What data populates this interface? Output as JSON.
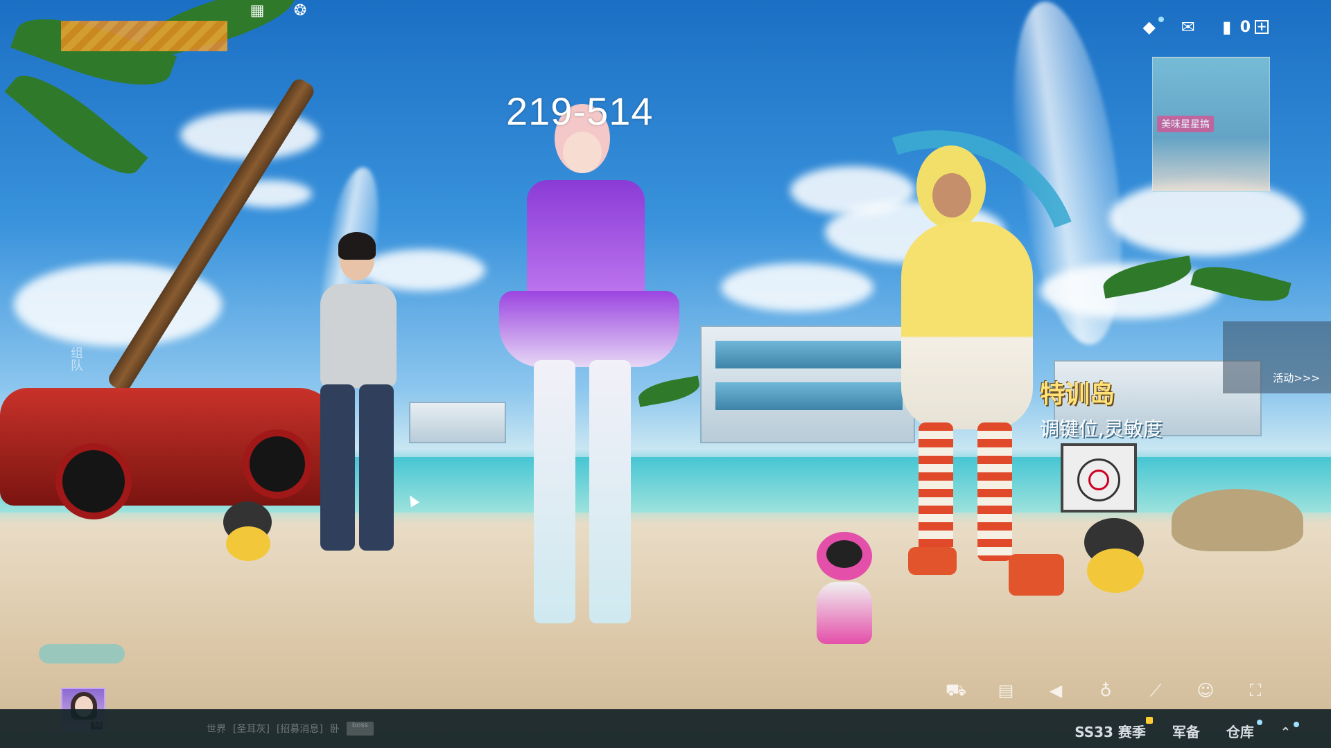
{
  "overlay": {
    "coordinates": "219-514"
  },
  "top_left": {
    "icons": [
      "grid-icon",
      "emblem-icon"
    ]
  },
  "top_right": {
    "icons": [
      "diamond-icon",
      "mail-icon",
      "card-icon"
    ],
    "currency_value": "0",
    "plus_label": "+"
  },
  "event_card": {
    "label": "美味星星搞"
  },
  "activity_card": {
    "label": "活动>>>"
  },
  "promo": {
    "title": "特训岛",
    "subtitle": "调键位,灵敏度"
  },
  "side": {
    "text": "组队"
  },
  "player": {
    "level": "38"
  },
  "chat": {
    "channel": "世界",
    "sender": "[圣耳灰]",
    "message": "[招募消息]",
    "suffix": "卧",
    "tag": "boss"
  },
  "controls": {
    "icons": [
      "vehicle-icon",
      "message-icon",
      "speaker-icon",
      "mic-icon",
      "wand-icon",
      "face-icon",
      "fullscreen-icon"
    ]
  },
  "nav": {
    "season": "SS33 赛季",
    "armory": "军备",
    "warehouse": "仓库",
    "expand": "⌃"
  },
  "colors": {
    "accent_orange": "#e58a1f",
    "bottom_bar": "#122226",
    "notify_dot": "#9fe1ff",
    "promo_title": "#ffe27a"
  }
}
